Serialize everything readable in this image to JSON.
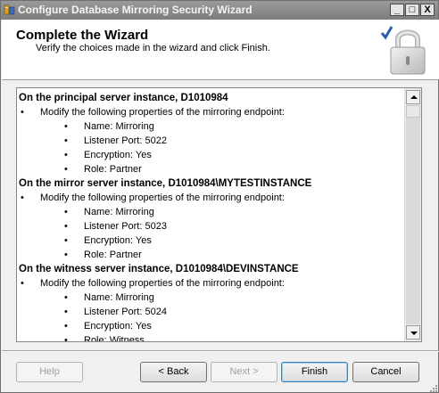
{
  "window": {
    "title": "Configure Database Mirroring Security Wizard",
    "controls": {
      "minimize": "_",
      "maximize": "□",
      "close": "X"
    }
  },
  "header": {
    "title": "Complete the Wizard",
    "subtitle": "Verify the choices made in the wizard and click Finish.",
    "icon": "padlock-icon"
  },
  "summary": {
    "sections": [
      {
        "heading": "On the principal server instance, D1010984",
        "action": "Modify the following properties of the mirroring endpoint:",
        "properties": [
          "Name: Mirroring",
          "Listener Port: 5022",
          "Encryption: Yes",
          "Role: Partner"
        ]
      },
      {
        "heading": "On the mirror server instance, D1010984\\MYTESTINSTANCE",
        "action": "Modify the following properties of the mirroring endpoint:",
        "properties": [
          "Name: Mirroring",
          "Listener Port: 5023",
          "Encryption: Yes",
          "Role: Partner"
        ]
      },
      {
        "heading": "On the witness server instance, D1010984\\DEVINSTANCE",
        "action": "Modify the following properties of the mirroring endpoint:",
        "properties": [
          "Name: Mirroring",
          "Listener Port: 5024",
          "Encryption: Yes",
          "Role: Witness"
        ]
      }
    ]
  },
  "buttons": {
    "help": "Help",
    "back": "< Back",
    "next": "Next >",
    "finish": "Finish",
    "cancel": "Cancel"
  },
  "colors": {
    "titlebar": "#8a8a8a",
    "dialog_bg": "#f0f0f0",
    "default_button_border": "#3c7fb1"
  }
}
